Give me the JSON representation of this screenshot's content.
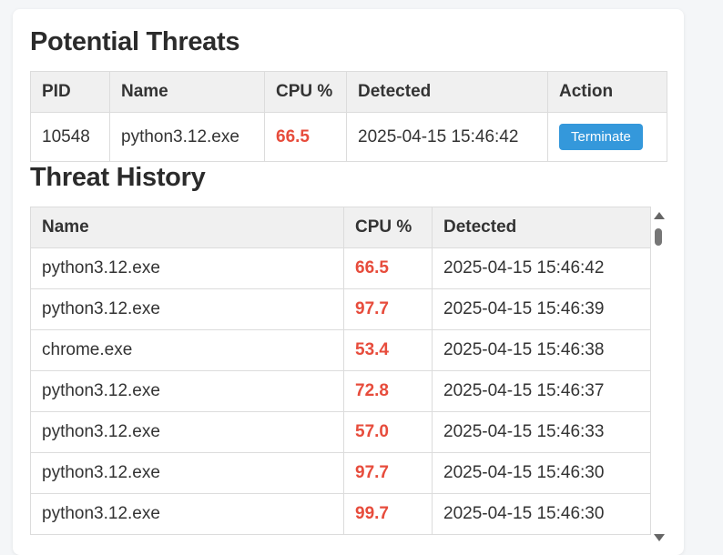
{
  "potential_threats": {
    "heading": "Potential Threats",
    "columns": [
      "PID",
      "Name",
      "CPU %",
      "Detected",
      "Action"
    ],
    "rows": [
      {
        "pid": "10548",
        "name": "python3.12.exe",
        "cpu": "66.5",
        "detected": "2025-04-15 15:46:42",
        "action_label": "Terminate"
      }
    ]
  },
  "threat_history": {
    "heading": "Threat History",
    "columns": [
      "Name",
      "CPU %",
      "Detected"
    ],
    "rows": [
      {
        "name": "python3.12.exe",
        "cpu": "66.5",
        "detected": "2025-04-15 15:46:42"
      },
      {
        "name": "python3.12.exe",
        "cpu": "97.7",
        "detected": "2025-04-15 15:46:39"
      },
      {
        "name": "chrome.exe",
        "cpu": "53.4",
        "detected": "2025-04-15 15:46:38"
      },
      {
        "name": "python3.12.exe",
        "cpu": "72.8",
        "detected": "2025-04-15 15:46:37"
      },
      {
        "name": "python3.12.exe",
        "cpu": "57.0",
        "detected": "2025-04-15 15:46:33"
      },
      {
        "name": "python3.12.exe",
        "cpu": "97.7",
        "detected": "2025-04-15 15:46:30"
      },
      {
        "name": "python3.12.exe",
        "cpu": "99.7",
        "detected": "2025-04-15 15:46:30"
      }
    ]
  },
  "colors": {
    "cpu_value": "#e74c3c",
    "button": "#3498db",
    "header_bg": "#f0f0f0"
  }
}
